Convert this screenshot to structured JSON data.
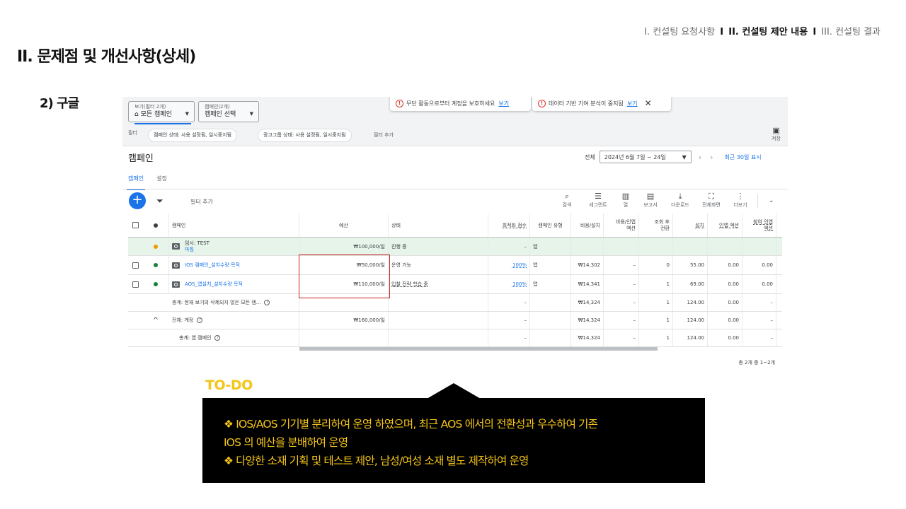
{
  "nav": {
    "item1": "I. 컨설팅 요청사항",
    "sep1": "I",
    "item2": "II. 컨설팅 제안 내용",
    "sep2": "I",
    "item3": "III. 컨설팅 결과"
  },
  "page_title": "II. 문제점 및 개선사항(상세)",
  "section_label": "2) 구글",
  "ads": {
    "view_selector": {
      "label": "보기(필터 2개)",
      "icon": "home-icon",
      "value": "모든 캠페인"
    },
    "campaign_selector": {
      "label": "캠페인(2개)",
      "value": "캠페인 선택"
    },
    "notice1": {
      "text": "무단 활동으로부터 계정을 보호하세요",
      "link": "보기"
    },
    "notice2": {
      "text": "데이터 기반 기여 분석이 중지됨",
      "link": "보기",
      "close": "✕"
    },
    "filter_label": "필터",
    "filter_chips": [
      "캠페인 상태: 사용 설정됨, 일시중지됨",
      "광고그룹 상태: 사용 설정됨, 일시중지됨"
    ],
    "add_filter": "필터 추가",
    "save_label": "저장",
    "section_title": "캠페인",
    "date": {
      "prefix": "전체",
      "range": "2024년 6월 7일 ~ 24일",
      "show_recent": "최근 30일 표시"
    },
    "tabs": [
      "캠페인",
      "설정"
    ],
    "toolbar": {
      "filter_placeholder": "필터 추가",
      "tools": [
        {
          "icon": "search-icon",
          "label": "검색"
        },
        {
          "icon": "segment-icon",
          "label": "세그먼트"
        },
        {
          "icon": "columns-icon",
          "label": "열"
        },
        {
          "icon": "report-icon",
          "label": "보고서"
        },
        {
          "icon": "download-icon",
          "label": "다운로드"
        },
        {
          "icon": "fullscreen-icon",
          "label": "전체화면"
        },
        {
          "icon": "more-icon",
          "label": "더보기"
        }
      ]
    },
    "columns": {
      "campaign": "캠페인",
      "budget": "예산",
      "status": "상태",
      "opt_score": "최적화 점수",
      "type": "캠페인 유형",
      "cost_install": "비용/설치",
      "cost_inapp_1": "비용/인앱",
      "cost_inapp_2": "액션",
      "view_conv_1": "조회 후",
      "view_conv_2": "전환",
      "installs": "설치",
      "inapp": "인앱 액션",
      "engage_1": "참여 인앱",
      "engage_2": "액션"
    },
    "rows": [
      {
        "name": "임시: TEST",
        "sub": "마침",
        "budget": "₩100,000/일",
        "status": "진행 중",
        "opt": "–",
        "type": "앱",
        "cost_install": "",
        "cost_inapp": "",
        "view_conv": "",
        "installs": "",
        "inapp": "",
        "engage": ""
      },
      {
        "name": "IOS 캠페인_설치수량 목적",
        "budget": "₩50,000/일",
        "status": "운영 가능",
        "opt": "100%",
        "type": "앱",
        "cost_install": "₩14,302",
        "cost_inapp": "–",
        "view_conv": "0",
        "installs": "55.00",
        "inapp": "0.00",
        "engage": "0.00"
      },
      {
        "name": "AOS_앱설치_설치수량 목적",
        "budget": "₩110,000/일",
        "status": "입찰 전략 학습 중",
        "opt": "100%",
        "type": "앱",
        "cost_install": "₩14,341",
        "cost_inapp": "–",
        "view_conv": "1",
        "installs": "69.00",
        "inapp": "0.00",
        "engage": "0.00"
      }
    ],
    "totals": [
      {
        "name": "총계: 현재 보기의 삭제되지 않은 모든 캠...",
        "budget": "",
        "opt": "–",
        "cost_install": "₩14,324",
        "cost_inapp": "–",
        "view_conv": "1",
        "installs": "124.00",
        "inapp": "0.00",
        "engage": "–"
      },
      {
        "name": "전체: 계정",
        "budget": "₩160,000/일",
        "opt": "–",
        "cost_install": "₩14,324",
        "cost_inapp": "–",
        "view_conv": "1",
        "installs": "124.00",
        "inapp": "0.00",
        "engage": "–"
      },
      {
        "name": "총계: 앱 캠페인",
        "budget": "",
        "opt": "–",
        "cost_install": "₩14,324",
        "cost_inapp": "–",
        "view_conv": "1",
        "installs": "124.00",
        "inapp": "0.00",
        "engage": "–"
      }
    ],
    "pagination": "총 2개 중 1~2개"
  },
  "todo": {
    "label": "TO-DO",
    "lines": [
      "❖ IOS/AOS 기기별 분리하여 운영 하였으며, 최근 AOS 에서의 전환성과 우수하여 기존",
      "IOS 의 예산을 분배하여 운영",
      "❖ 다양한 소재 기획 및 테스트 제안, 남성/여성 소재 별도 제작하여 운영"
    ]
  },
  "colors": {
    "accent": "#1a73e8",
    "todo": "#f5c518",
    "highlight_row": "#e6f4ea",
    "red_box": "#c5221f"
  }
}
